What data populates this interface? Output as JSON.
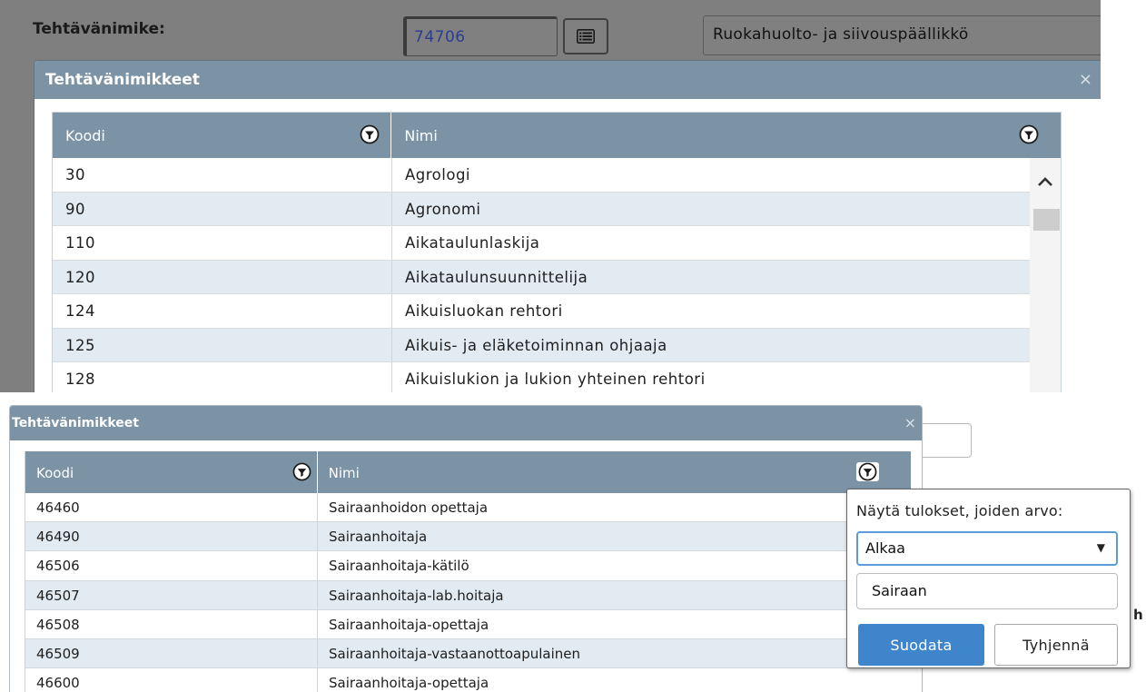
{
  "top": {
    "field_label": "Tehtävänimike:",
    "code_value": "74706",
    "name_value": "Ruokahuolto- ja siivouspäällikkö",
    "dialog": {
      "title": "Tehtävänimikkeet",
      "close": "×",
      "columns": {
        "code": "Koodi",
        "name": "Nimi"
      },
      "rows": [
        {
          "code": "30",
          "name": "Agrologi"
        },
        {
          "code": "90",
          "name": "Agronomi"
        },
        {
          "code": "110",
          "name": "Aikataulunlaskija"
        },
        {
          "code": "120",
          "name": "Aikataulunsuunnittelija"
        },
        {
          "code": "124",
          "name": "Aikuisluokan rehtori"
        },
        {
          "code": "125",
          "name": "Aikuis- ja eläketoiminnan ohjaaja"
        },
        {
          "code": "128",
          "name": "Aikuislukion ja lukion yhteinen rehtori"
        }
      ]
    }
  },
  "bottom": {
    "dialog": {
      "title": "Tehtävänimikkeet",
      "close": "×",
      "columns": {
        "code": "Koodi",
        "name": "Nimi"
      },
      "rows": [
        {
          "code": "46460",
          "name": "Sairaanhoidon opettaja"
        },
        {
          "code": "46490",
          "name": "Sairaanhoitaja"
        },
        {
          "code": "46506",
          "name": "Sairaanhoitaja-kätilö"
        },
        {
          "code": "46507",
          "name": "Sairaanhoitaja-lab.hoitaja"
        },
        {
          "code": "46508",
          "name": "Sairaanhoitaja-opettaja"
        },
        {
          "code": "46509",
          "name": "Sairaanhoitaja-vastaanottoapulainen"
        },
        {
          "code": "46600",
          "name": "Sairaanhoitaja-opettaja"
        }
      ]
    },
    "filter_popup": {
      "label": "Näytä tulokset, joiden arvo:",
      "operator": "Alkaa",
      "value": "Sairaan",
      "apply_label": "Suodata",
      "clear_label": "Tyhjennä"
    },
    "background_letter": "h"
  },
  "colors": {
    "header_bg": "#7b93a5",
    "alt_row": "#e2ebf1",
    "primary_button": "#3f85cc",
    "overlay": "#7f7f7f"
  }
}
